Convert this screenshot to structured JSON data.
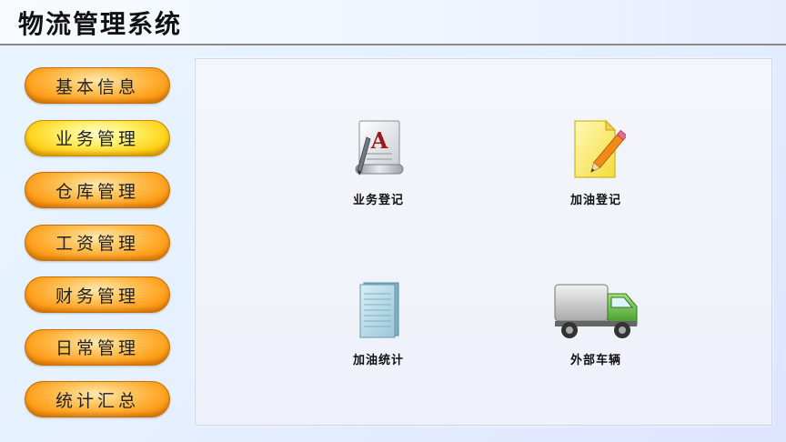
{
  "app": {
    "title": "物流管理系统"
  },
  "sidebar": {
    "items": [
      {
        "label": "基本信息",
        "active": false
      },
      {
        "label": "业务管理",
        "active": true
      },
      {
        "label": "仓库管理",
        "active": false
      },
      {
        "label": "工资管理",
        "active": false
      },
      {
        "label": "财务管理",
        "active": false
      },
      {
        "label": "日常管理",
        "active": false
      },
      {
        "label": "统计汇总",
        "active": false
      }
    ]
  },
  "main": {
    "tiles": [
      {
        "label": "业务登记",
        "icon": "document-letter-a-icon"
      },
      {
        "label": "加油登记",
        "icon": "notepad-pencil-icon"
      },
      {
        "label": "加油统计",
        "icon": "ledger-book-icon"
      },
      {
        "label": "外部车辆",
        "icon": "truck-icon"
      }
    ]
  },
  "colors": {
    "nav_button": "#ff9f1c",
    "nav_button_active": "#ffd21a",
    "background": "#e6f0ff",
    "panel": "#f2f4fa"
  }
}
